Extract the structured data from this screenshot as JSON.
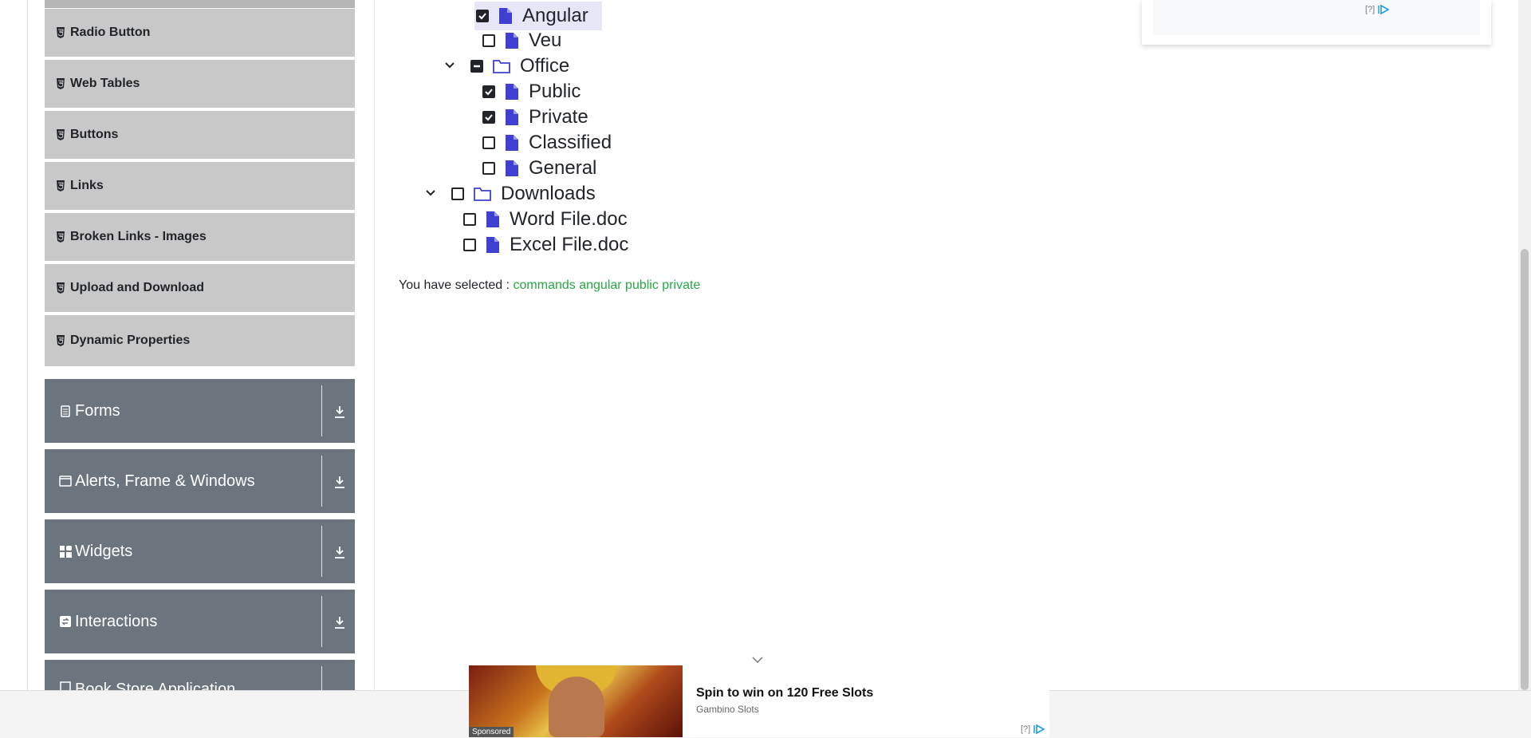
{
  "sidebar": {
    "elements_items": [
      {
        "label": "Radio Button"
      },
      {
        "label": "Web Tables"
      },
      {
        "label": "Buttons"
      },
      {
        "label": "Links"
      },
      {
        "label": "Broken Links - Images"
      },
      {
        "label": "Upload and Download"
      },
      {
        "label": "Dynamic Properties"
      }
    ],
    "groups": [
      {
        "label": "Forms",
        "icon": "clipboard-icon"
      },
      {
        "label": "Alerts, Frame & Windows",
        "icon": "window-icon"
      },
      {
        "label": "Widgets",
        "icon": "grid-icon"
      },
      {
        "label": "Interactions",
        "icon": "interaction-icon"
      },
      {
        "label": "Book Store Application",
        "icon": "book-icon"
      }
    ]
  },
  "tree": {
    "nodes": [
      {
        "label": "Angular",
        "type": "file",
        "state": "checked"
      },
      {
        "label": "Veu",
        "type": "file",
        "state": "unchecked"
      },
      {
        "label": "Office",
        "type": "folder",
        "state": "partial",
        "expanded": true
      },
      {
        "label": "Public",
        "type": "file",
        "state": "checked"
      },
      {
        "label": "Private",
        "type": "file",
        "state": "checked"
      },
      {
        "label": "Classified",
        "type": "file",
        "state": "unchecked"
      },
      {
        "label": "General",
        "type": "file",
        "state": "unchecked"
      },
      {
        "label": "Downloads",
        "type": "folder",
        "state": "unchecked",
        "expanded": true
      },
      {
        "label": "Word File.doc",
        "type": "file",
        "state": "unchecked"
      },
      {
        "label": "Excel File.doc",
        "type": "file",
        "state": "unchecked"
      }
    ]
  },
  "result": {
    "prefix": "You have selected :",
    "selected": "commands angular public private"
  },
  "ads": {
    "top_marker": "[?]",
    "bottom": {
      "title": "Spin to win on 120 Free Slots",
      "brand": "Gambino Slots",
      "sponsored": "Sponsored",
      "marker": "[?]"
    }
  },
  "colors": {
    "group_bg": "#6c757d",
    "item_bg": "#c8c8c8",
    "selected_text": "#28a745",
    "tree_icon": "#3f3fd1"
  }
}
